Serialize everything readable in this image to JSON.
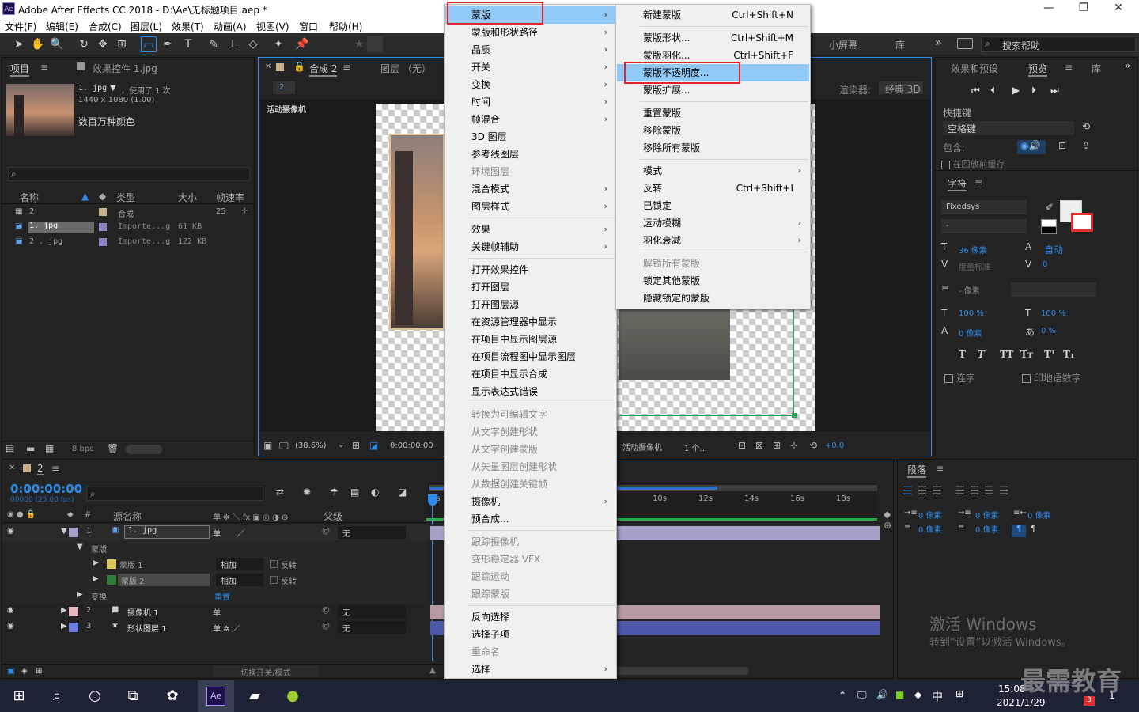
{
  "window": {
    "title": "Adobe After Effects CC 2018 - D:\\Ae\\无标题项目.aep *",
    "app_icon": "Ae",
    "minimize": "—",
    "maximize": "❐",
    "close": "✕"
  },
  "menubar": [
    "文件(F)",
    "编辑(E)",
    "合成(C)",
    "图层(L)",
    "效果(T)",
    "动画(A)",
    "视图(V)",
    "窗口",
    "帮助(H)"
  ],
  "toolbar": {
    "workspaces": [
      "小屏幕",
      "库"
    ],
    "more": "»",
    "search_placeholder": "搜索帮助"
  },
  "project": {
    "tab": "项目",
    "tab_menu": "≡",
    "effects_tab": "效果控件 1.jpg",
    "file_name": "1. jpg",
    "used": "，使用了 1 次",
    "dims": "1440 x 1080 (1.00)",
    "color_label": "数百万种颜色",
    "search_placeholder": "",
    "columns": [
      "名称",
      "类型",
      "大小",
      "帧速率"
    ],
    "items": [
      {
        "name": "2",
        "type": "合成",
        "size": "",
        "fps": "25"
      },
      {
        "name": "1. jpg",
        "type": "Importe...g",
        "size": "61 KB",
        "fps": ""
      },
      {
        "name": "2 . jpg",
        "type": "Importe...g",
        "size": "122 KB",
        "fps": ""
      }
    ],
    "bpc": "8 bpc"
  },
  "composition": {
    "tab": "合成 2",
    "tab_menu": "≡",
    "layer_tab": "图层 （无）",
    "breadcrumb": "2",
    "renderer_label": "渲染器:",
    "renderer": "经典 3D",
    "camera_label": "活动摄像机",
    "zoom": "(38.6%)",
    "timecode": "0:00:00:00",
    "view_camera": "活动摄像机",
    "views": "1 个...",
    "exposure": "+0.0"
  },
  "timeline": {
    "tab": "2",
    "timecode": "0:00:00:00",
    "fps_info": "00000 (25.00 fps)",
    "search_placeholder": "",
    "col_source": "源名称",
    "col_parent": "父级",
    "ruler": [
      "10s",
      "12s",
      "14s",
      "16s",
      "18s"
    ],
    "ruler_start": "0s",
    "layers": [
      {
        "num": "1",
        "name": "1. jpg",
        "parent": "无",
        "color": "#a9a0c8"
      },
      {
        "num": "2",
        "name": "摄像机 1",
        "parent": "无",
        "color": "#e7b6c0"
      },
      {
        "num": "3",
        "name": "形状图层 1",
        "parent": "无",
        "color": "#6d7ce0"
      }
    ],
    "mask_group": "蒙版",
    "masks": [
      {
        "name": "蒙版 1",
        "mode": "相加",
        "invert": "反转"
      },
      {
        "name": "蒙版 2",
        "mode": "相加",
        "invert": "反转"
      }
    ],
    "transform": "变换",
    "reset": "重置",
    "footer": "切换开关/模式"
  },
  "right_panel": {
    "tabs": [
      "效果和预设",
      "预览",
      "库"
    ],
    "shortcut_label": "快捷键",
    "shortcut_value": "空格键",
    "include_label": "包含:",
    "cache_label": "在回放前缓存",
    "char_tab": "字符",
    "font": "Fixedsys",
    "font_style": "-",
    "font_size": "36 像素",
    "leading": "自动",
    "tracking_label": "度量标准",
    "tracking": "0",
    "stroke": "- 像素",
    "vscale": "100 %",
    "hscale": "100 %",
    "baseline": "0 像素",
    "tsume": "0 %",
    "ligature": "连字",
    "hindi": "印地语数字",
    "styles": [
      "T",
      "T",
      "TT",
      "Tт",
      "T¹",
      "T₁"
    ]
  },
  "paragraph": {
    "tab": "段落",
    "indent_values": [
      "0 像素",
      "0 像素",
      "0 像素",
      "0 像素",
      "0 像素"
    ]
  },
  "context_menu": {
    "items": [
      {
        "label": "蒙版",
        "arrow": true,
        "state": "hl"
      },
      {
        "label": "蒙版和形状路径",
        "arrow": true
      },
      {
        "label": "品质",
        "arrow": true
      },
      {
        "label": "开关",
        "arrow": true
      },
      {
        "label": "变换",
        "arrow": true
      },
      {
        "label": "时间",
        "arrow": true
      },
      {
        "label": "帧混合",
        "arrow": true
      },
      {
        "label": "3D 图层"
      },
      {
        "label": "参考线图层"
      },
      {
        "label": "环境图层",
        "state": "dis"
      },
      {
        "label": "混合模式",
        "arrow": true
      },
      {
        "label": "图层样式",
        "arrow": true
      },
      {
        "label": "效果",
        "arrow": true,
        "sep": true
      },
      {
        "label": "关键帧辅助",
        "arrow": true
      },
      {
        "label": "打开效果控件",
        "sep": true
      },
      {
        "label": "打开图层"
      },
      {
        "label": "打开图层源"
      },
      {
        "label": "在资源管理器中显示"
      },
      {
        "label": "在项目中显示图层源"
      },
      {
        "label": "在项目流程图中显示图层"
      },
      {
        "label": "在项目中显示合成"
      },
      {
        "label": "显示表达式错误"
      },
      {
        "label": "转换为可编辑文字",
        "state": "dis",
        "sep": true
      },
      {
        "label": "从文字创建形状",
        "state": "dis"
      },
      {
        "label": "从文字创建蒙版",
        "state": "dis"
      },
      {
        "label": "从矢量图层创建形状",
        "state": "dis"
      },
      {
        "label": "从数据创建关键帧",
        "state": "dis"
      },
      {
        "label": "摄像机",
        "arrow": true
      },
      {
        "label": "预合成..."
      },
      {
        "label": "跟踪摄像机",
        "state": "dis",
        "sep": true
      },
      {
        "label": "变形稳定器 VFX",
        "state": "dis"
      },
      {
        "label": "跟踪运动",
        "state": "dis"
      },
      {
        "label": "跟踪蒙版",
        "state": "dis"
      },
      {
        "label": "反向选择",
        "sep": true
      },
      {
        "label": "选择子项"
      },
      {
        "label": "重命名",
        "state": "dis"
      },
      {
        "label": "选择",
        "arrow": true
      }
    ]
  },
  "submenu": {
    "items": [
      {
        "label": "新建蒙版",
        "shortcut": "Ctrl+Shift+N"
      },
      {
        "label": "蒙版形状...",
        "shortcut": "Ctrl+Shift+M",
        "sep": true
      },
      {
        "label": "蒙版羽化...",
        "shortcut": "Ctrl+Shift+F"
      },
      {
        "label": "蒙版不透明度...",
        "shortcut": "",
        "state": "hl"
      },
      {
        "label": "蒙版扩展..."
      },
      {
        "label": "重置蒙版",
        "sep": true
      },
      {
        "label": "移除蒙版"
      },
      {
        "label": "移除所有蒙版"
      },
      {
        "label": "模式",
        "arrow": true,
        "sep": true
      },
      {
        "label": "反转",
        "shortcut": "Ctrl+Shift+I"
      },
      {
        "label": "已锁定"
      },
      {
        "label": "运动模糊",
        "arrow": true
      },
      {
        "label": "羽化衰减",
        "arrow": true
      },
      {
        "label": "解锁所有蒙版",
        "state": "dis",
        "sep": true
      },
      {
        "label": "锁定其他蒙版"
      },
      {
        "label": "隐藏锁定的蒙版"
      }
    ]
  },
  "watermark": {
    "activate_title": "激活 Windows",
    "activate_sub": "转到“设置”以激活 Windows。",
    "brand": "最需教育"
  },
  "taskbar": {
    "time": "15:08",
    "date": "2021/1/29",
    "ime": "中",
    "badge": "3",
    "notif": "1"
  }
}
